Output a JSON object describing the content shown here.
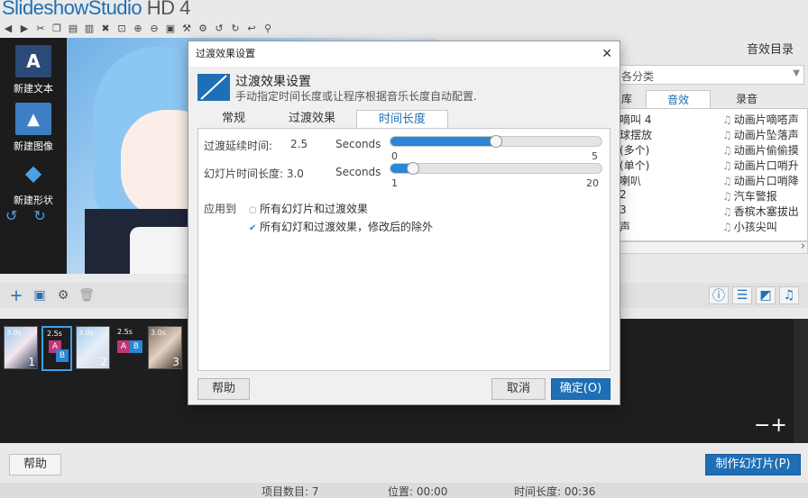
{
  "app": {
    "title_main": "SlideshowStudio",
    "title_hd": " HD 4"
  },
  "left_panel": {
    "items": [
      {
        "label": "新建文本",
        "icon": "text-icon"
      },
      {
        "label": "新建图像",
        "icon": "image-icon"
      },
      {
        "label": "新建形状",
        "icon": "shape-icon"
      }
    ]
  },
  "right_panel": {
    "header": "音效目录",
    "category_value": "各分类",
    "tabs": {
      "library": "库",
      "effects": "音效",
      "record": "录音"
    },
    "left_column": [
      "嘀叫 4",
      "球摆放",
      "(多个)",
      "(单个)",
      "喇叭",
      "2",
      "3",
      "声"
    ],
    "right_column": [
      "动画片嘀嗒声",
      "动画片坠落声",
      "动画片偷偷摸",
      "动画片口哨升",
      "动画片口哨降",
      "汽车警报",
      "香槟木塞拔出",
      "小孩尖叫"
    ]
  },
  "timeline": {
    "slides": [
      {
        "duration": "3.0s",
        "number": "1"
      },
      {
        "duration": "3.0s",
        "number": "2"
      },
      {
        "duration": "3.0s",
        "number": "3"
      }
    ],
    "transitions": [
      {
        "duration": "2.5s",
        "letter_a": "A",
        "letter_b": "B"
      },
      {
        "duration": "2.5s",
        "letter_a": "A",
        "letter_b": "B"
      }
    ],
    "zoom": "−+"
  },
  "bottom": {
    "help": "帮助",
    "make": "制作幻灯片(P)",
    "status": {
      "items": "项目数目: 7",
      "position": "位置: 00:00",
      "length": "时间长度: 00:36"
    }
  },
  "dialog": {
    "title": "过渡效果设置",
    "heading": "过渡效果设置",
    "subheading": "手动指定时间长度或让程序根据音乐长度自动配置.",
    "tabs": {
      "general": "常规",
      "transition": "过渡效果",
      "duration": "时间长度"
    },
    "transition_delay": {
      "label": "过渡延续时间:",
      "value": "2.5",
      "unit": "Seconds",
      "min": "0",
      "max": "5",
      "fraction": 0.5
    },
    "slide_duration": {
      "label": "幻灯片时间长度: 3.0",
      "unit": "Seconds",
      "min": "1",
      "max": "20",
      "fraction": 0.105
    },
    "apply_to": {
      "label": "应用到",
      "option_all": "所有幻灯片和过渡效果",
      "option_except": "所有幻灯和过渡效果，修改后的除外"
    },
    "help": "帮助",
    "cancel": "取消",
    "ok": "确定(O)"
  }
}
